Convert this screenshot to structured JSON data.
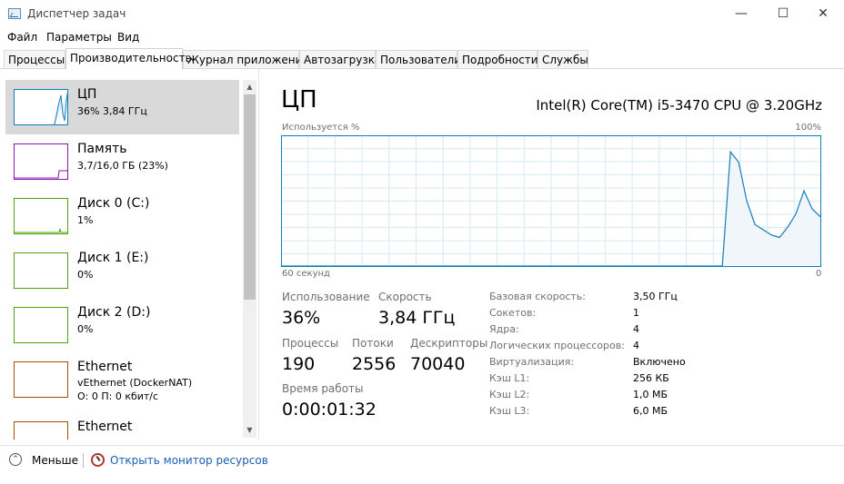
{
  "window": {
    "title": "Диспетчер задач",
    "minimize_icon": "minimize-icon",
    "maximize_icon": "maximize-icon",
    "close_icon": "close-icon"
  },
  "menu": [
    "Файл",
    "Параметры",
    "Вид"
  ],
  "tabs": [
    "Процессы",
    "Производительность",
    "Журнал приложений",
    "Автозагрузка",
    "Пользователи",
    "Подробности",
    "Службы"
  ],
  "active_tab": "Производительность",
  "sidebar": [
    {
      "name": "ЦП",
      "detail": "36% 3,84 ГГц",
      "color": "#117dbb"
    },
    {
      "name": "Память",
      "detail": "3,7/16,0 ГБ (23%)",
      "color": "#8b12ae"
    },
    {
      "name": "Диск 0 (C:)",
      "detail": "1%",
      "color": "#4da60c"
    },
    {
      "name": "Диск 1 (E:)",
      "detail": "0%",
      "color": "#4da60c"
    },
    {
      "name": "Диск 2 (D:)",
      "detail": "0%",
      "color": "#4da60c"
    },
    {
      "name": "Ethernet",
      "detail": "vEthernet (DockerNAT)",
      "detail2": "О: 0 П: 0 кбит/с",
      "color": "#a74f01"
    },
    {
      "name": "Ethernet",
      "detail": "",
      "color": "#a74f01"
    }
  ],
  "main": {
    "title": "ЦП",
    "cpu_model": "Intel(R) Core(TM) i5-3470 CPU @ 3.20GHz",
    "graph_top_left": "Используется %",
    "graph_top_right": "100%",
    "graph_bottom_left": "60 секунд",
    "graph_bottom_right": "0",
    "graph_color": "#117dbb",
    "graph_fill": "#f1f6fa",
    "graph_grid": "#d9eaf4",
    "usage_series": [
      0,
      0,
      0,
      0,
      0,
      0,
      0,
      0,
      0,
      0,
      0,
      0,
      0,
      0,
      0,
      0,
      0,
      0,
      0,
      0,
      0,
      0,
      0,
      0,
      0,
      0,
      0,
      0,
      0,
      0,
      0,
      0,
      0,
      0,
      0,
      0,
      0,
      0,
      0,
      0,
      0,
      0,
      0,
      0,
      0,
      0,
      0,
      0,
      0,
      0,
      0,
      0,
      0,
      0,
      0,
      88,
      80,
      50,
      32,
      28,
      24,
      22,
      30,
      40,
      58,
      44,
      38
    ]
  },
  "stats": {
    "usage_label": "Использование",
    "usage_value": "36%",
    "speed_label": "Скорость",
    "speed_value": "3,84 ГГц",
    "processes_label": "Процессы",
    "processes_value": "190",
    "threads_label": "Потоки",
    "threads_value": "2556",
    "handles_label": "Дескрипторы",
    "handles_value": "70040",
    "uptime_label": "Время работы",
    "uptime_value": "0:00:01:32"
  },
  "specs": [
    {
      "label": "Базовая скорость:",
      "value": "3,50 ГГц"
    },
    {
      "label": "Сокетов:",
      "value": "1"
    },
    {
      "label": "Ядра:",
      "value": "4"
    },
    {
      "label": "Логических процессоров:",
      "value": "4"
    },
    {
      "label": "Виртуализация:",
      "value": "Включено"
    },
    {
      "label": "Кэш L1:",
      "value": "256 КБ"
    },
    {
      "label": "Кэш L2:",
      "value": "1,0 МБ"
    },
    {
      "label": "Кэш L3:",
      "value": "6,0 МБ"
    }
  ],
  "footer": {
    "less_label": "Меньше",
    "monitor_label": "Открыть монитор ресурсов"
  }
}
